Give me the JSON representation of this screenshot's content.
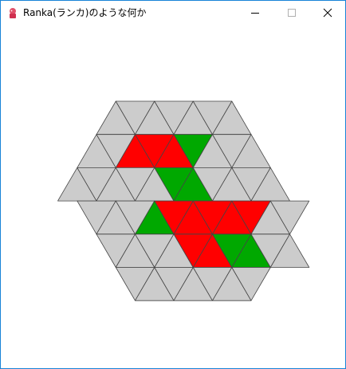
{
  "window": {
    "title": "Ranka(ランカ)のような何か"
  },
  "controls": {
    "minimize_icon": "minimize-icon",
    "maximize_icon": "maximize-icon",
    "close_icon": "close-icon"
  },
  "board": {
    "shape": "hexagon",
    "side_length_cells": 3,
    "colors": {
      "empty": "#cccccc",
      "red": "#ff0000",
      "green": "#00a800",
      "grid_line": "#444444"
    },
    "rows": [
      {
        "row": 0,
        "cells": [
          "empty",
          "empty",
          "empty",
          "empty",
          "empty",
          "empty",
          "empty"
        ]
      },
      {
        "row": 1,
        "cells": [
          "empty",
          "empty",
          "red",
          "red",
          "red",
          "green",
          "empty",
          "empty",
          "empty"
        ]
      },
      {
        "row": 2,
        "cells": [
          "empty",
          "empty",
          "empty",
          "empty",
          "empty",
          "green",
          "green",
          "empty",
          "empty",
          "empty",
          "empty"
        ]
      },
      {
        "row": 3,
        "cells": [
          "empty",
          "empty",
          "empty",
          "green",
          "red",
          "red",
          "red",
          "red",
          "red",
          "empty",
          "empty"
        ]
      },
      {
        "row": 4,
        "cells": [
          "empty",
          "empty",
          "empty",
          "empty",
          "red",
          "red",
          "green",
          "green",
          "empty",
          "empty"
        ]
      },
      {
        "row": 5,
        "cells": [
          "empty",
          "empty",
          "empty",
          "empty",
          "empty",
          "empty",
          "empty"
        ]
      }
    ]
  }
}
